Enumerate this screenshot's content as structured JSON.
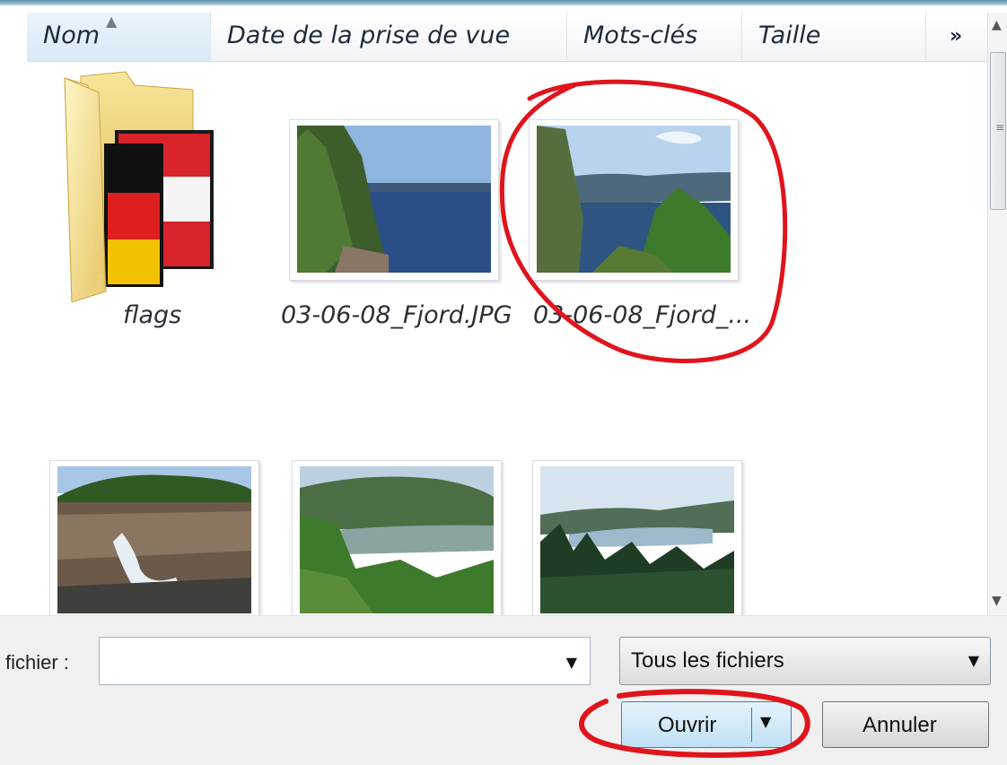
{
  "columns": {
    "name": "Nom",
    "date": "Date de la prise de vue",
    "keywords": "Mots-clés",
    "size": "Taille",
    "more": "»"
  },
  "items": [
    {
      "label": "flags",
      "type": "folder"
    },
    {
      "label": "03-06-08_Fjord.JPG",
      "type": "image"
    },
    {
      "label": "03-06-08_Fjord_...",
      "type": "image"
    },
    {
      "label": "",
      "type": "image"
    },
    {
      "label": "",
      "type": "image"
    },
    {
      "label": "",
      "type": "image"
    }
  ],
  "bottom": {
    "filename_label": "fichier :",
    "filename_value": "",
    "filter_value": "Tous les fichiers",
    "open_label": "Ouvrir",
    "cancel_label": "Annuler"
  },
  "colors": {
    "annotation": "#e0141c",
    "open_button_border": "#3c7fb1"
  }
}
